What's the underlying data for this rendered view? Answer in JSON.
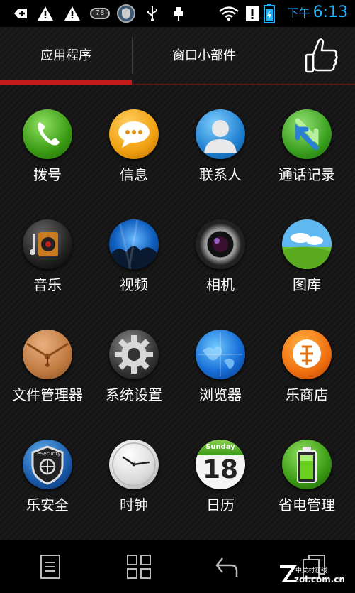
{
  "status_bar": {
    "battery_label": "78",
    "time_ampm": "下午",
    "time": "6:13",
    "time_color": "#1fb2ff",
    "icons": [
      "add-icon",
      "warning-icon",
      "warning-icon",
      "battery-78-icon",
      "security-shield-icon",
      "usb-icon",
      "usb-debug-icon",
      "wifi-icon",
      "warning-icon",
      "battery-icon"
    ]
  },
  "tabs": [
    {
      "label": "应用程序",
      "active": true
    },
    {
      "label": "窗口小部件",
      "active": false
    }
  ],
  "accent_color": "#c41a1a",
  "apps": [
    {
      "label": "拨号",
      "icon": "phone-icon"
    },
    {
      "label": "信息",
      "icon": "message-icon"
    },
    {
      "label": "联系人",
      "icon": "contacts-icon"
    },
    {
      "label": "通话记录",
      "icon": "call-log-icon"
    },
    {
      "label": "音乐",
      "icon": "music-icon"
    },
    {
      "label": "视频",
      "icon": "video-icon"
    },
    {
      "label": "相机",
      "icon": "camera-icon"
    },
    {
      "label": "图库",
      "icon": "gallery-icon"
    },
    {
      "label": "文件管理器",
      "icon": "file-manager-icon"
    },
    {
      "label": "系统设置",
      "icon": "settings-icon"
    },
    {
      "label": "浏览器",
      "icon": "browser-icon"
    },
    {
      "label": "乐商店",
      "icon": "store-icon"
    },
    {
      "label": "乐安全",
      "icon": "security-icon"
    },
    {
      "label": "时钟",
      "icon": "clock-icon"
    },
    {
      "label": "日历",
      "icon": "calendar-icon"
    },
    {
      "label": "省电管理",
      "icon": "power-manager-icon"
    }
  ],
  "calendar": {
    "day_name": "Sunday",
    "day_number": "18"
  },
  "shield_text": "LeSecurity",
  "watermark": {
    "line1": "中关村在线",
    "line2": "zol.com.cn"
  }
}
